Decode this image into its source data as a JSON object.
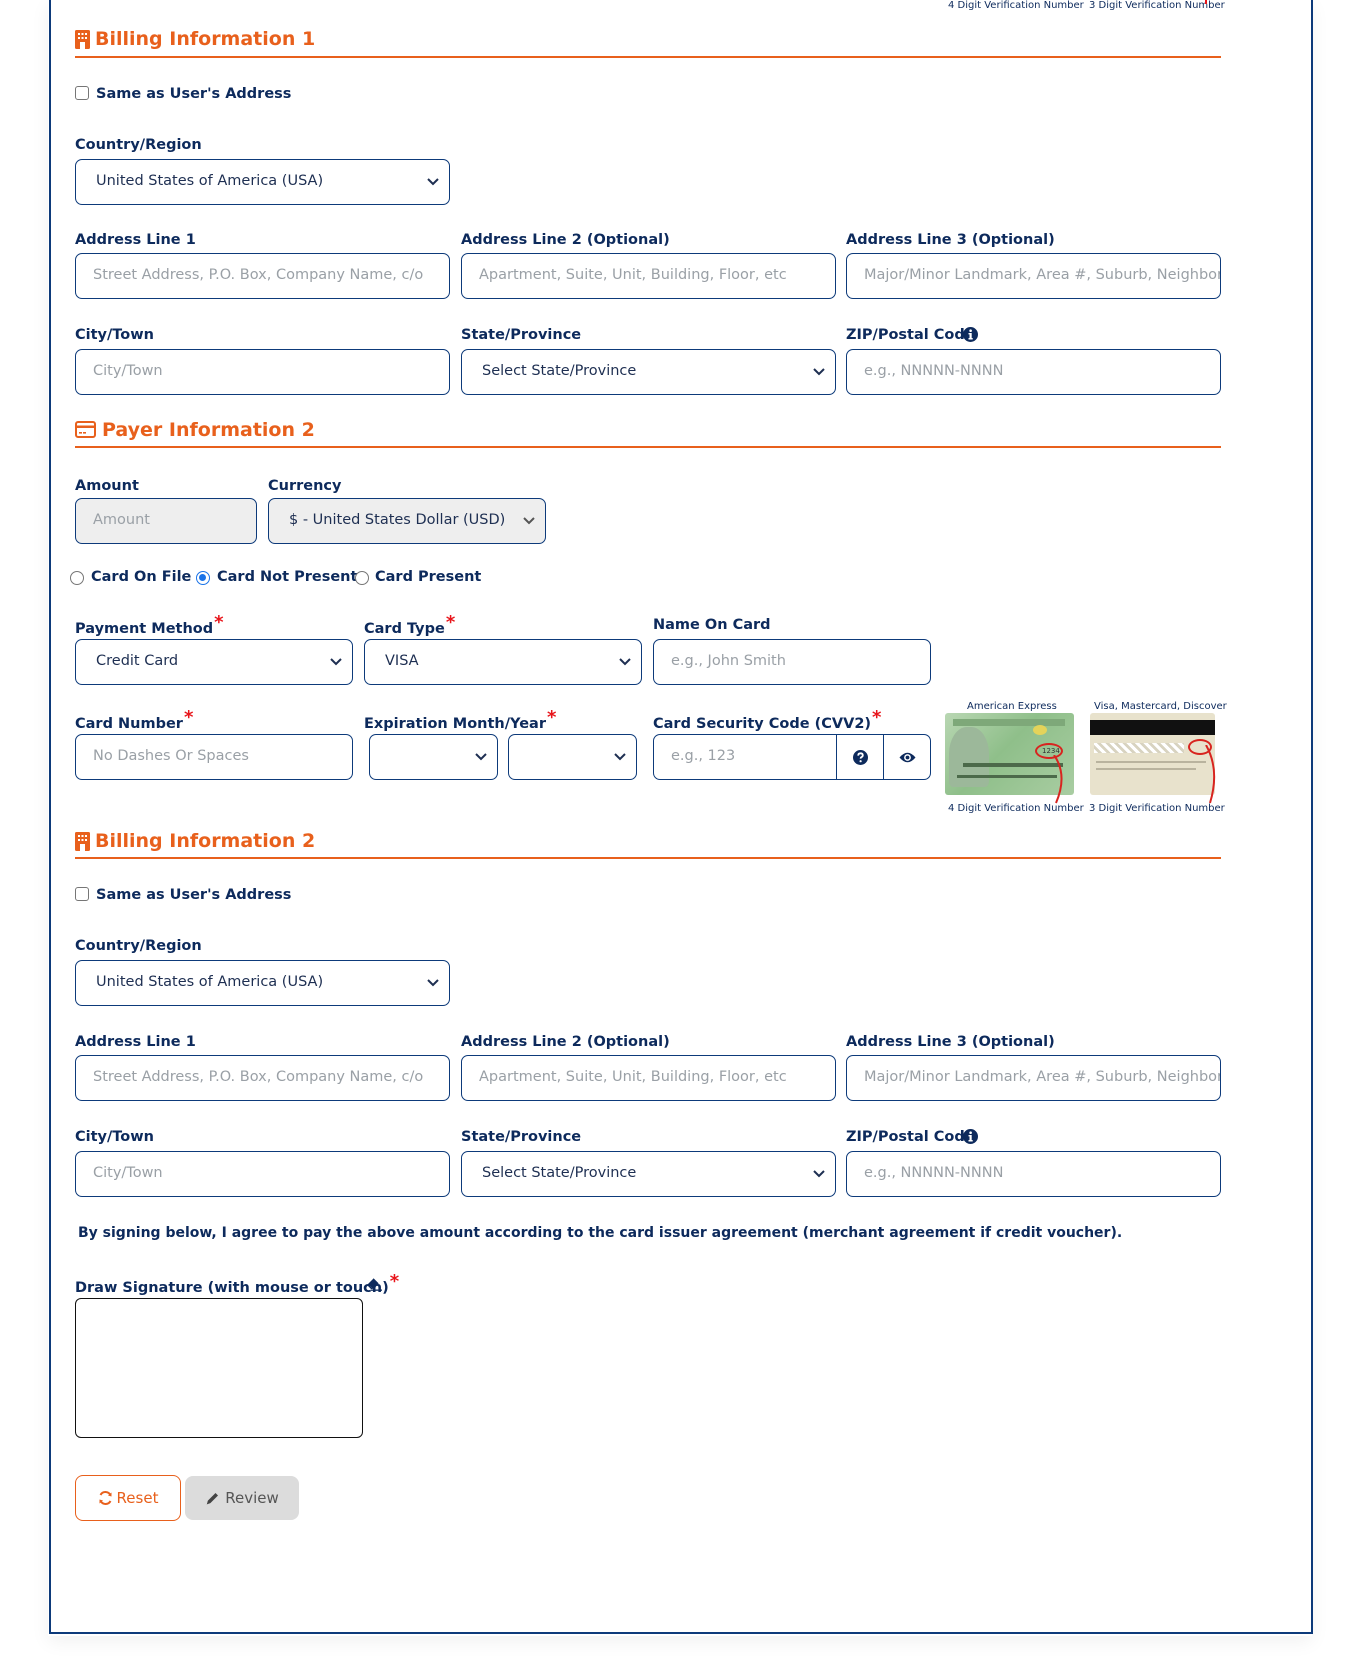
{
  "top_captions": {
    "amex_caption": "4 Digit Verification Number",
    "visa_caption": "3 Digit Verification Number"
  },
  "billing1": {
    "title": "Billing Information 1",
    "same_as_user": "Same as User's Address",
    "country_label": "Country/Region",
    "country_value": "United States of America (USA)",
    "addr1_label": "Address Line 1",
    "addr1_placeholder": "Street Address, P.O. Box, Company Name, c/o",
    "addr2_label": "Address Line 2 (Optional)",
    "addr2_placeholder": "Apartment, Suite, Unit, Building, Floor, etc",
    "addr3_label": "Address Line 3 (Optional)",
    "addr3_placeholder": "Major/Minor Landmark, Area #, Suburb, Neighborhood",
    "city_label": "City/Town",
    "city_placeholder": "City/Town",
    "state_label": "State/Province",
    "state_value": "Select State/Province",
    "zip_label": "ZIP/Postal Code",
    "zip_placeholder": "e.g., NNNNN-NNNN"
  },
  "payer2": {
    "title": "Payer Information 2",
    "amount_label": "Amount",
    "amount_placeholder": "Amount",
    "currency_label": "Currency",
    "currency_value": "$ - United States Dollar (USD)",
    "radio_options": [
      "Card On File",
      "Card Not Present",
      "Card Present"
    ],
    "radio_selected": "Card Not Present",
    "payment_method_label": "Payment Method",
    "payment_method_value": "Credit Card",
    "card_type_label": "Card Type",
    "card_type_value": "VISA",
    "name_on_card_label": "Name On Card",
    "name_on_card_placeholder": "e.g., John Smith",
    "card_number_label": "Card Number",
    "card_number_placeholder": "No Dashes Or Spaces",
    "expiration_label": "Expiration Month/Year",
    "expiration_month_value": "",
    "expiration_year_value": "",
    "cvv_label": "Card Security Code (CVV2)",
    "cvv_placeholder": "e.g., 123",
    "amex_title": "American Express",
    "amex_caption": "4 Digit Verification Number",
    "amex_code": "1234",
    "visa_title": "Visa, Mastercard, Discover",
    "visa_caption": "3 Digit Verification Number"
  },
  "billing2": {
    "title": "Billing Information 2",
    "same_as_user": "Same as User's Address",
    "country_label": "Country/Region",
    "country_value": "United States of America (USA)",
    "addr1_label": "Address Line 1",
    "addr1_placeholder": "Street Address, P.O. Box, Company Name, c/o",
    "addr2_label": "Address Line 2 (Optional)",
    "addr2_placeholder": "Apartment, Suite, Unit, Building, Floor, etc",
    "addr3_label": "Address Line 3 (Optional)",
    "addr3_placeholder": "Major/Minor Landmark, Area #, Suburb, Neighborhood",
    "city_label": "City/Town",
    "city_placeholder": "City/Town",
    "state_label": "State/Province",
    "state_value": "Select State/Province",
    "zip_label": "ZIP/Postal Code",
    "zip_placeholder": "e.g., NNNNN-NNNN"
  },
  "agreement_text": "By signing below, I agree to pay the above amount according to the card issuer agreement (merchant agreement if credit voucher).",
  "signature": {
    "label": "Draw Signature (with mouse or touch)"
  },
  "buttons": {
    "reset": "Reset",
    "review": "Review"
  },
  "colors": {
    "accent": "#e8601c",
    "primary": "#0d3a7a",
    "required": "#e8151b",
    "radio_selected": "#1a73e8"
  }
}
